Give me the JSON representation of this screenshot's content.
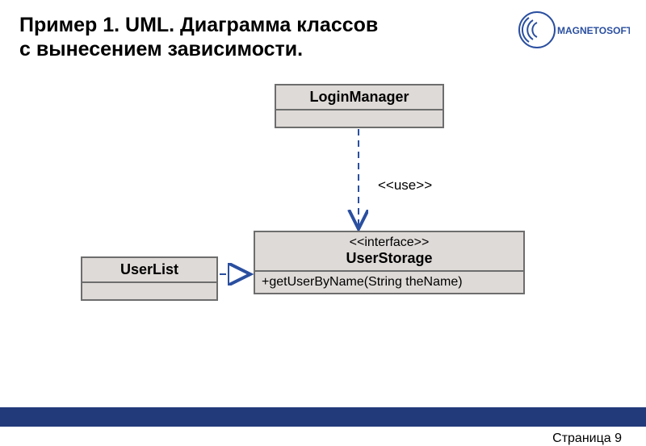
{
  "title_line1": "Пример 1. UML. Диаграмма классов",
  "title_line2": "с вынесением зависимости.",
  "logo_text": "MAGNETOSOFT",
  "page_label": "Страница 9",
  "classes": {
    "loginManager": {
      "name": "LoginManager"
    },
    "userList": {
      "name": "UserList"
    },
    "userStorage": {
      "stereotype": "<<interface>>",
      "name": "UserStorage",
      "operation": "+getUserByName(String theName)"
    }
  },
  "relationships": {
    "use_label": "<<use>>"
  }
}
